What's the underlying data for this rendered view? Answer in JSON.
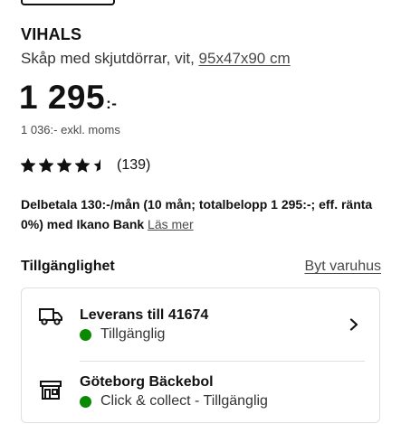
{
  "product": {
    "name": "VIHALS",
    "description": "Skåp med skjutdörrar, vit, ",
    "measurements": "95x47x90 cm",
    "price": "1 295",
    "price_suffix": ":-",
    "price_excl_vat": "1 036:- exkl. moms",
    "rating": 4.5,
    "rating_count": "(139)"
  },
  "installment": {
    "text": "Delbetala 130:-/mån (10 mån; totalbelopp 1 295:-; eff. ränta 0%) med Ikano Bank",
    "link": "Läs mer"
  },
  "availability": {
    "title": "Tillgänglighet",
    "change_store": "Byt varuhus",
    "options": [
      {
        "icon": "truck-icon",
        "title": "Leverans till 41674",
        "status": "Tillgänglig",
        "status_color": "#0a8a00"
      },
      {
        "icon": "store-icon",
        "title": "Göteborg Bäckebol",
        "status": "Click & collect - Tillgänglig",
        "status_color": "#0a8a00"
      }
    ]
  },
  "colors": {
    "text": "#111111",
    "muted": "#484848",
    "border": "#dfdfdf",
    "available": "#0a8a00"
  }
}
